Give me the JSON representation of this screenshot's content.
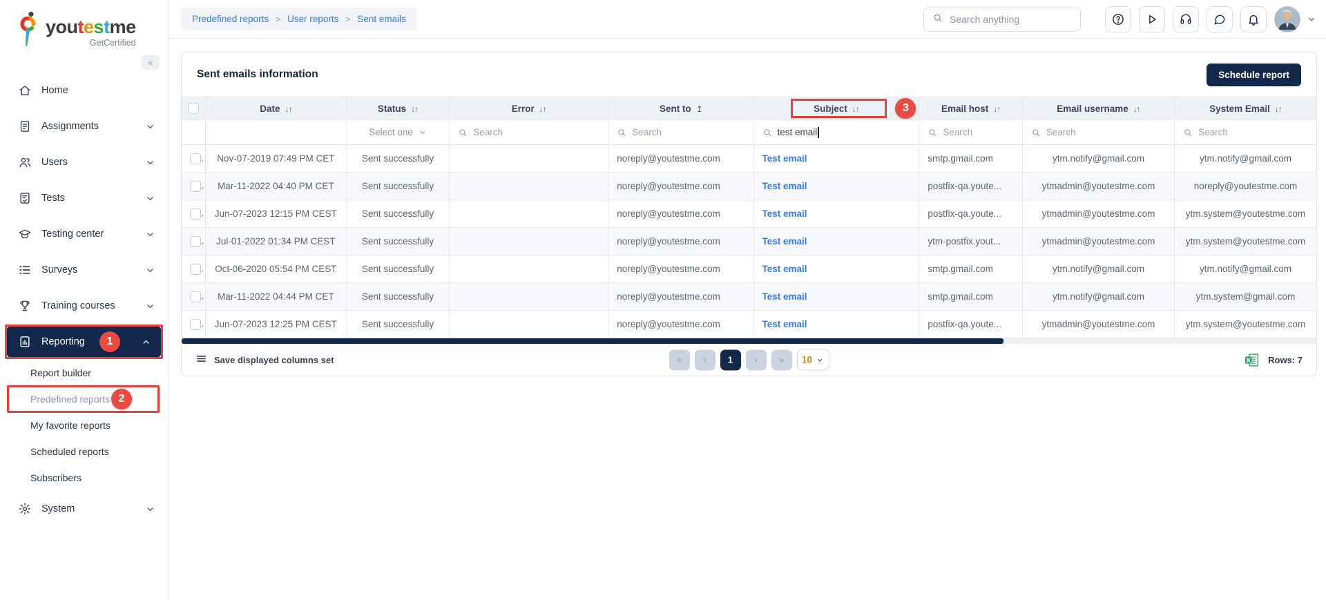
{
  "colors": {
    "brand_navy": "#13294b",
    "annotation_red": "#e6403a",
    "link_blue": "#2e7ceb",
    "header_row_bg": "#eef1f5",
    "excel_green": "#21a366",
    "page_size_orange": "#d48806"
  },
  "sidebar": {
    "logo": {
      "letters": [
        {
          "ch": "you",
          "color": "#3c3c3b"
        },
        {
          "ch": "t",
          "color": "#e6332a"
        },
        {
          "ch": "e",
          "color": "#f39200"
        },
        {
          "ch": "s",
          "color": "#3aaa35"
        },
        {
          "ch": "t",
          "color": "#36a9e1"
        },
        {
          "ch": "me",
          "color": "#3c3c3b"
        }
      ],
      "subtitle": "GetCertified"
    },
    "collapse_glyph": "«",
    "items": [
      {
        "label": "Home",
        "icon": "home-icon",
        "level": 1
      },
      {
        "label": "Assignments",
        "icon": "assignments-icon",
        "level": 1,
        "chevron": "down"
      },
      {
        "label": "Users",
        "icon": "users-icon",
        "level": 1,
        "chevron": "down"
      },
      {
        "label": "Tests",
        "icon": "tests-icon",
        "level": 1,
        "chevron": "down"
      },
      {
        "label": "Testing center",
        "icon": "testing-center-icon",
        "level": 1,
        "chevron": "down"
      },
      {
        "label": "Surveys",
        "icon": "surveys-icon",
        "level": 1,
        "chevron": "down"
      },
      {
        "label": "Training courses",
        "icon": "training-courses-icon",
        "level": 1,
        "chevron": "down"
      },
      {
        "label": "Reporting",
        "icon": "reporting-icon",
        "level": 1,
        "chevron": "up",
        "active": true,
        "annotation": "1"
      },
      {
        "label": "Report builder",
        "level": 2
      },
      {
        "label": "Predefined reports",
        "level": 2,
        "selected": true,
        "annotation": "2"
      },
      {
        "label": "My favorite reports",
        "level": 2
      },
      {
        "label": "Scheduled reports",
        "level": 2
      },
      {
        "label": "Subscribers",
        "level": 2
      },
      {
        "label": "System",
        "icon": "system-icon",
        "level": 1,
        "chevron": "down"
      }
    ]
  },
  "topbar": {
    "breadcrumb": [
      "Predefined reports",
      "User reports",
      "Sent emails"
    ],
    "breadcrumb_separator": ">",
    "search_placeholder": "Search anything",
    "action_icons": [
      "help-icon",
      "play-icon",
      "support-icon",
      "chat-icon",
      "notifications-icon"
    ]
  },
  "report": {
    "title": "Sent emails information",
    "schedule_button_label": "Schedule report",
    "columns": [
      {
        "key": "date",
        "label": "Date",
        "sort": "both",
        "align": "c"
      },
      {
        "key": "status",
        "label": "Status",
        "sort": "both",
        "align": "c"
      },
      {
        "key": "error",
        "label": "Error",
        "sort": "both",
        "align": "c"
      },
      {
        "key": "sent_to",
        "label": "Sent to",
        "sort": "asc",
        "align": "l"
      },
      {
        "key": "subject",
        "label": "Subject",
        "sort": "both",
        "align": "l",
        "annotation": "3"
      },
      {
        "key": "email_host",
        "label": "Email host",
        "sort": "both",
        "align": "l"
      },
      {
        "key": "email_username",
        "label": "Email username",
        "sort": "both",
        "align": "c"
      },
      {
        "key": "system_email",
        "label": "System Email",
        "sort": "both",
        "align": "c"
      }
    ],
    "filters": [
      {
        "key": "date",
        "type": "none"
      },
      {
        "key": "status",
        "type": "select",
        "label": "Select one"
      },
      {
        "key": "error",
        "type": "search",
        "placeholder": "Search"
      },
      {
        "key": "sent_to",
        "type": "search",
        "placeholder": "Search"
      },
      {
        "key": "subject",
        "type": "text",
        "value": "test email"
      },
      {
        "key": "email_host",
        "type": "search",
        "placeholder": "Search"
      },
      {
        "key": "email_username",
        "type": "search",
        "placeholder": "Search"
      },
      {
        "key": "system_email",
        "type": "search",
        "placeholder": "Search"
      }
    ],
    "rows": [
      {
        "date": "Nov-07-2019 07:49 PM CET",
        "status": "Sent successfully",
        "error": "",
        "sent_to": "noreply@youtestme.com",
        "subject": "Test email",
        "email_host": "smtp.gmail.com",
        "email_username": "ytm.notify@gmail.com",
        "system_email": "ytm.notify@gmail.com"
      },
      {
        "date": "Mar-11-2022 04:40 PM CET",
        "status": "Sent successfully",
        "error": "",
        "sent_to": "noreply@youtestme.com",
        "subject": "Test email",
        "email_host": "postfix-qa.youte...",
        "email_username": "ytmadmin@youtestme.com",
        "system_email": "noreply@youtestme.com"
      },
      {
        "date": "Jun-07-2023 12:15 PM CEST",
        "status": "Sent successfully",
        "error": "",
        "sent_to": "noreply@youtestme.com",
        "subject": "Test email",
        "email_host": "postfix-qa.youte...",
        "email_username": "ytmadmin@youtestme.com",
        "system_email": "ytm.system@youtestme.com"
      },
      {
        "date": "Jul-01-2022 01:34 PM CEST",
        "status": "Sent successfully",
        "error": "",
        "sent_to": "noreply@youtestme.com",
        "subject": "Test email",
        "email_host": "ytm-postfix.yout...",
        "email_username": "ytmadmin@youtestme.com",
        "system_email": "ytm.system@youtestme.com"
      },
      {
        "date": "Oct-06-2020 05:54 PM CEST",
        "status": "Sent successfully",
        "error": "",
        "sent_to": "noreply@youtestme.com",
        "subject": "Test email",
        "email_host": "smtp.gmail.com",
        "email_username": "ytm.notify@gmail.com",
        "system_email": "ytm.notify@gmail.com"
      },
      {
        "date": "Mar-11-2022 04:44 PM CET",
        "status": "Sent successfully",
        "error": "",
        "sent_to": "noreply@youtestme.com",
        "subject": "Test email",
        "email_host": "smtp.gmail.com",
        "email_username": "ytm.notify@gmail.com",
        "system_email": "ytm.system@gmail.com"
      },
      {
        "date": "Jun-07-2023 12:25 PM CEST",
        "status": "Sent successfully",
        "error": "",
        "sent_to": "noreply@youtestme.com",
        "subject": "Test email",
        "email_host": "postfix-qa.youte...",
        "email_username": "ytmadmin@youtestme.com",
        "system_email": "ytm.system@youtestme.com"
      }
    ],
    "footer": {
      "save_columns_label": "Save displayed columns set",
      "pagination": {
        "first": "«",
        "prev": "‹",
        "pages": [
          "1"
        ],
        "active_page": "1",
        "next": "›",
        "last": "»"
      },
      "page_size": "10",
      "rows_count_label": "Rows: 7"
    }
  },
  "annotations": {
    "step1": "1",
    "step2": "2",
    "step3": "3"
  }
}
